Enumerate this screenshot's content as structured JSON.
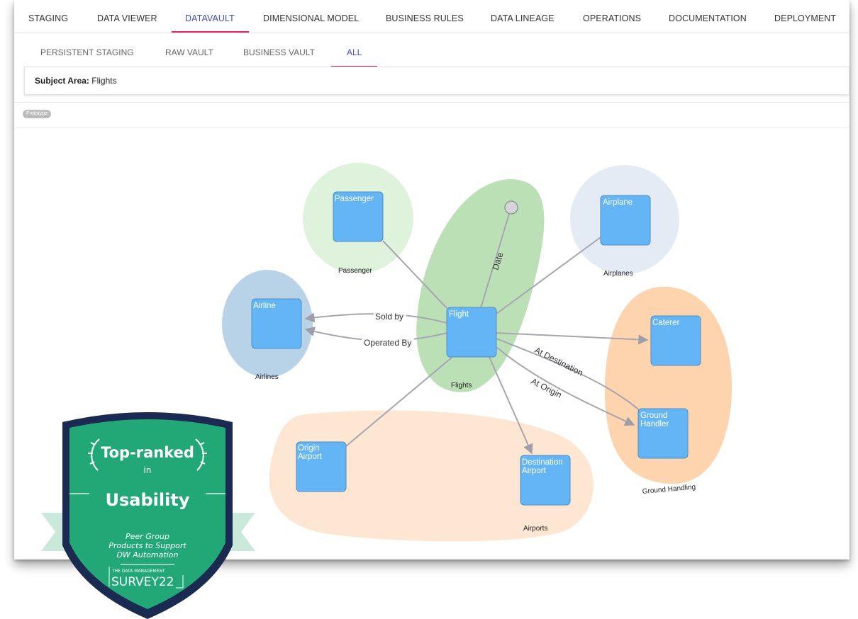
{
  "top_tabs": [
    {
      "label": "STAGING"
    },
    {
      "label": "DATA VIEWER"
    },
    {
      "label": "DATAVAULT",
      "active": true
    },
    {
      "label": "DIMENSIONAL MODEL"
    },
    {
      "label": "BUSINESS RULES"
    },
    {
      "label": "DATA LINEAGE"
    },
    {
      "label": "OPERATIONS"
    },
    {
      "label": "DOCUMENTATION"
    },
    {
      "label": "DEPLOYMENT"
    }
  ],
  "sub_tabs": [
    {
      "label": "PERSISTENT STAGING"
    },
    {
      "label": "RAW VAULT"
    },
    {
      "label": "BUSINESS VAULT"
    },
    {
      "label": "ALL",
      "active": true
    }
  ],
  "subject_area": {
    "label": "Subject Area:",
    "value": "Flights"
  },
  "prototype_badge": "Prototype",
  "groups": [
    "Passenger",
    "Airplanes",
    "Airlines",
    "Flights",
    "Ground Handling",
    "Airports"
  ],
  "nodes": [
    "Passenger",
    "Airplane",
    "Airline",
    "Flight",
    "Caterer",
    "Ground Handler",
    "Origin Airport",
    "Destination Airport"
  ],
  "edge_labels": [
    "Date",
    "Sold by",
    "Operated By",
    "At Destination",
    "At Origin"
  ],
  "award": {
    "line1": "Top-ranked",
    "line2": "in",
    "line3": "Usability",
    "peer1": "Peer Group",
    "peer2": "Products to Support",
    "peer3": "DW Automation",
    "survey_small": "THE DATA MANAGEMENT",
    "survey_big": "SURVEY22"
  },
  "colors": {
    "accent": "#3f51b5",
    "tab_indicator": "#e91e63",
    "node_fill": "#64b5f6",
    "award_green": "#22a877",
    "award_navy": "#1b2a50"
  }
}
